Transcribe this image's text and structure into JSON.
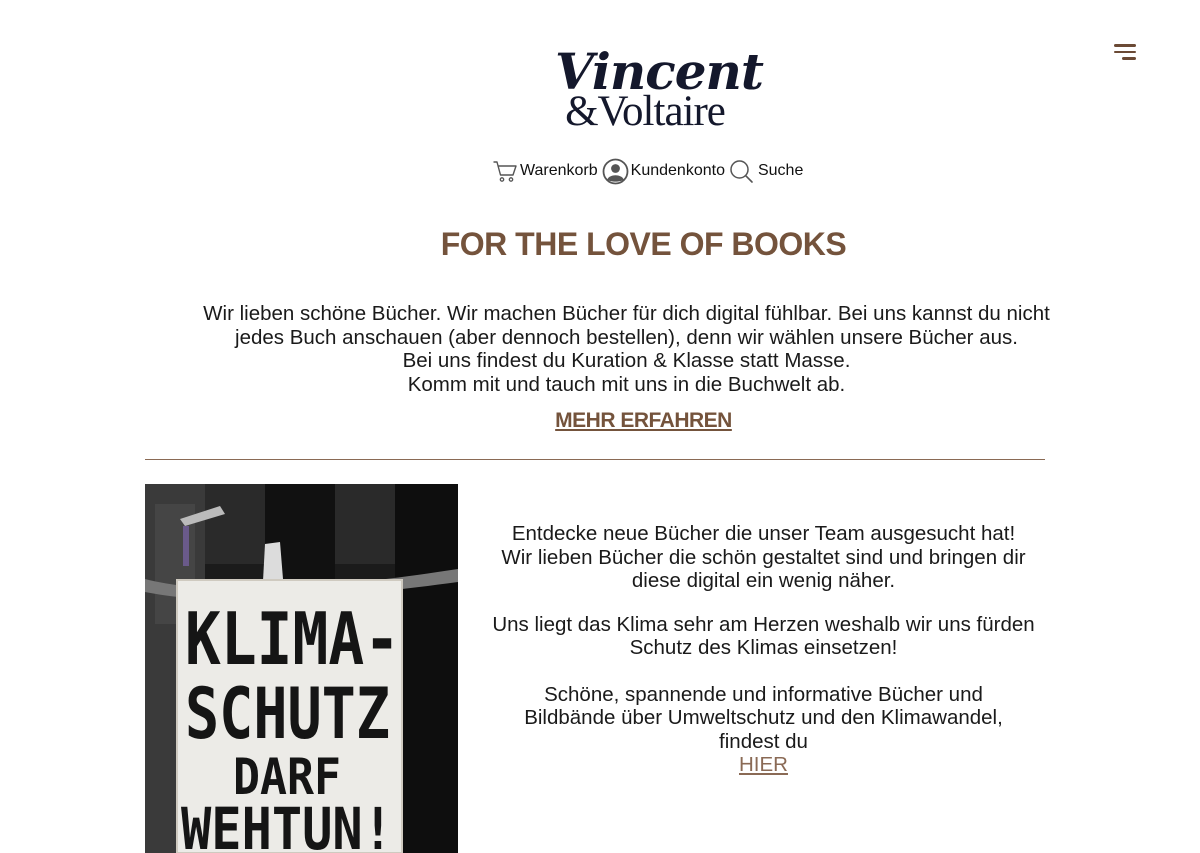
{
  "logo": {
    "line1": "Vincent",
    "line2": "&Voltaire"
  },
  "nav": {
    "cart_label": "Warenkorb",
    "account_label": "Kundenkonto",
    "search_label": "Suche"
  },
  "hero": {
    "headline": "FOR THE LOVE OF BOOKS",
    "lines": [
      "Wir lieben schöne Bücher. Wir machen Bücher für dich digital fühlbar. Bei uns kannst du nicht",
      "jedes Buch anschauen (aber dennoch bestellen), denn wir wählen unsere Bücher aus.",
      "Bei uns findest du Kuration & Klasse statt Masse.",
      "Komm mit und tauch mit uns in die Buchwelt ab."
    ],
    "more_link": "MEHR ERFAHREN"
  },
  "feature": {
    "sign_lines": [
      "KLIMA-",
      "SCHUTZ",
      "DARF",
      "WEHTUN!"
    ],
    "p1": [
      "Entdecke neue Bücher die unser Team ausgesucht hat!",
      "Wir lieben Bücher die schön gestaltet sind und bringen dir",
      "diese digital ein wenig näher."
    ],
    "p2": [
      "Uns liegt das Klima sehr am Herzen weshalb wir uns fürden",
      "Schutz des Klimas einsetzen!"
    ],
    "p3": [
      "Schöne, spannende und informative Bücher und",
      "Bildbände über Umweltschutz und den Klimawandel,",
      "findest du"
    ],
    "link": "HIER"
  },
  "colors": {
    "accent": "#74533c",
    "link": "#8a6a55",
    "text": "#1a1a1a",
    "logo": "#14182c"
  },
  "icons": [
    "menu-icon",
    "cart-icon",
    "user-icon",
    "search-icon"
  ]
}
